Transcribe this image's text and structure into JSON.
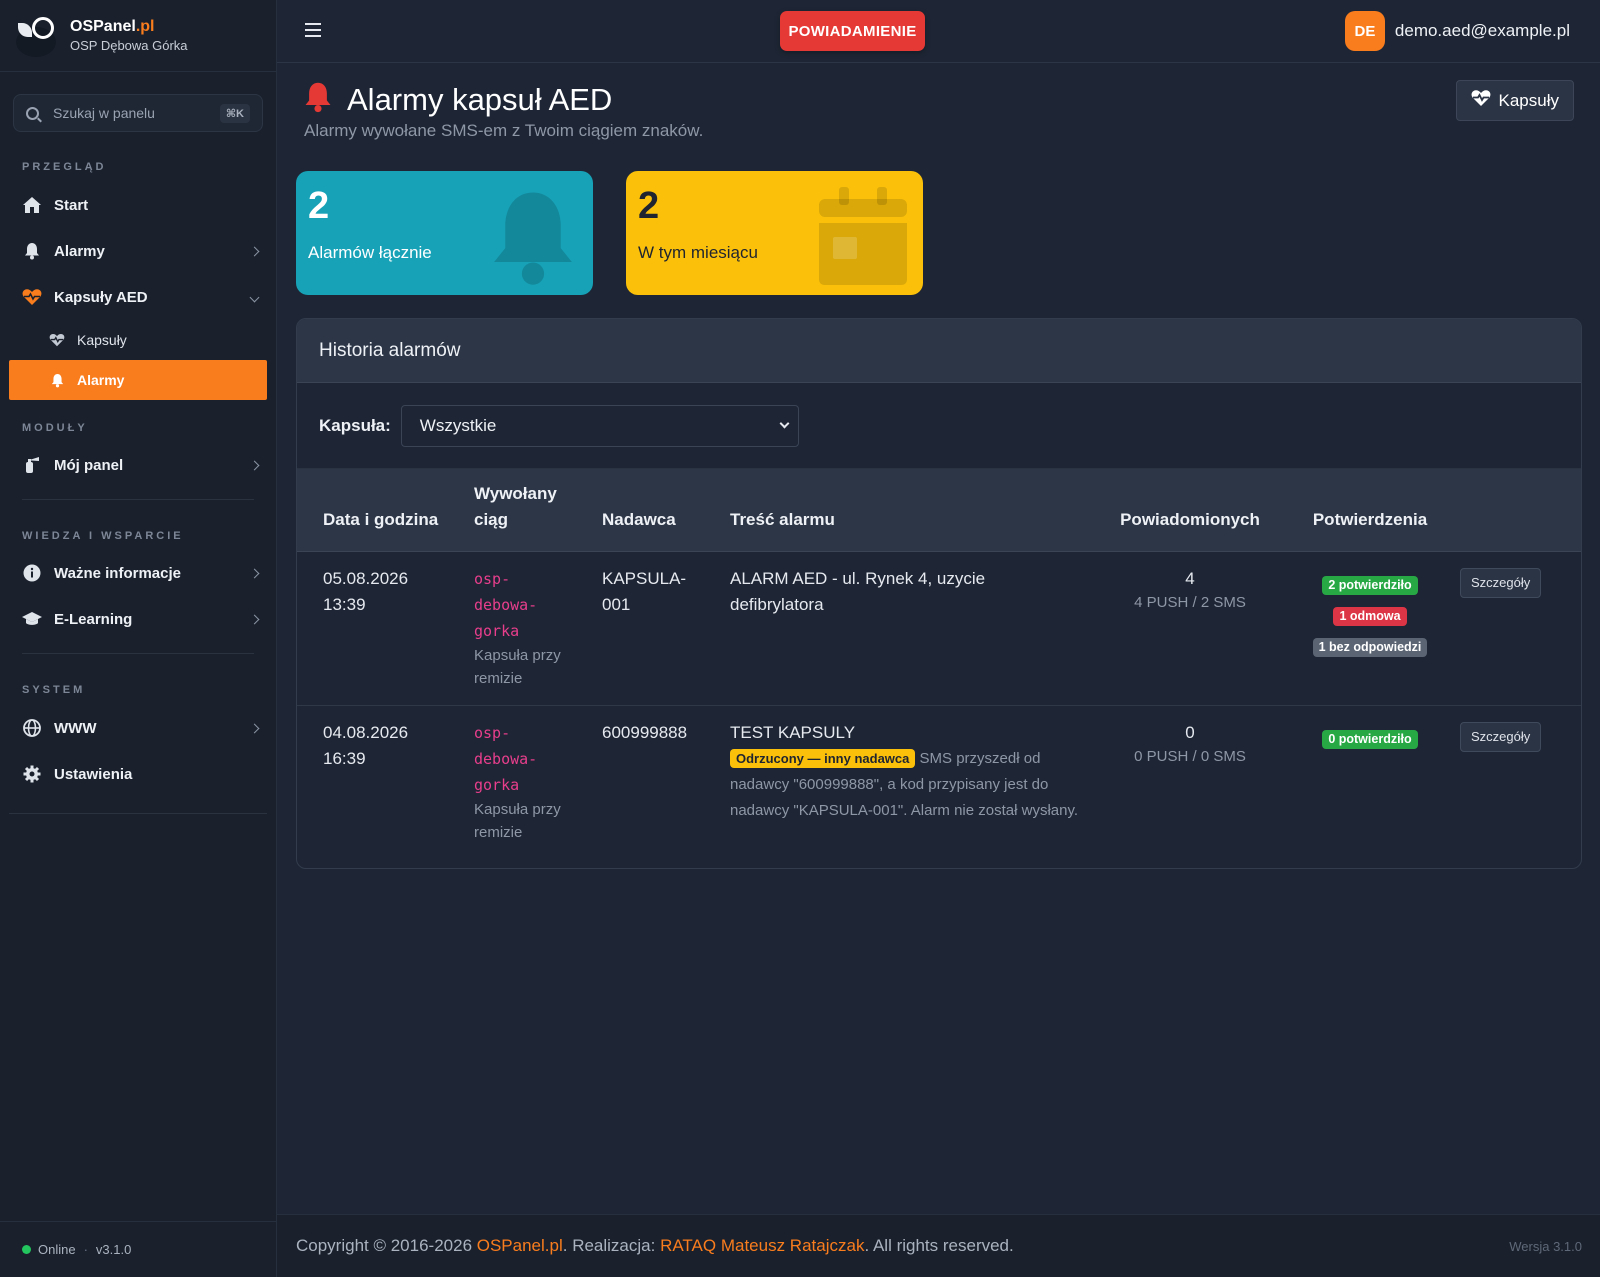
{
  "brand": {
    "name": "OSPanel",
    "tld": ".pl",
    "subtitle": "OSP Dębowa Górka"
  },
  "search": {
    "placeholder": "Szukaj w panelu",
    "shortcut": "⌘K"
  },
  "sidebar": {
    "sections": {
      "przeglad": "PRZEGLĄD",
      "moduly": "MODUŁY",
      "wiedza": "WIEDZA I WSPARCIE",
      "system": "SYSTEM"
    },
    "items": {
      "start": "Start",
      "alarmy": "Alarmy",
      "kapsuly_aed": "Kapsuły AED",
      "kapsuly_sub": "Kapsuły",
      "alarmy_sub": "Alarmy",
      "moj_panel": "Mój panel",
      "wazne": "Ważne informacje",
      "elearning": "E-Learning",
      "www": "WWW",
      "ustawienia": "Ustawienia"
    },
    "status": {
      "online": "Online",
      "version": "v3.1.0"
    }
  },
  "topbar": {
    "notify_label": "POWIADAMIENIE",
    "avatar_initials": "DE",
    "user_email": "demo.aed@example.pl"
  },
  "page": {
    "title": "Alarmy kapsuł AED",
    "subtitle": "Alarmy wywołane SMS-em z Twoim ciągiem znaków.",
    "kapsuly_button": "Kapsuły"
  },
  "stats": [
    {
      "value": "2",
      "label": "Alarmów łącznie",
      "icon": "bell-icon",
      "color": "#17a2b8"
    },
    {
      "value": "2",
      "label": "W tym miesiącu",
      "icon": "calendar-icon",
      "color": "#fbc10a"
    }
  ],
  "history": {
    "title": "Historia alarmów",
    "filter_label": "Kapsuła:",
    "filter_value": "Wszystkie",
    "columns": {
      "date": "Data i godzina",
      "ciag": "Wywołany ciąg",
      "nadawca": "Nadawca",
      "tresc": "Treść alarmu",
      "pow": "Powiadomionych",
      "pot": "Potwierdzenia"
    },
    "rows": [
      {
        "date": "05.08.2026",
        "time": "13:39",
        "ciag": "osp-debowa-gorka",
        "ciag_desc": "Kapsuła przy remizie",
        "nadawca": "KAPSULA-001",
        "tresc": "ALARM AED - ul. Rynek 4, uzycie defibrylatora",
        "pow_count": "4",
        "pow_detail": "4 PUSH / 2 SMS",
        "confirmed": "2 potwierdziło",
        "rejected": "1 odmowa",
        "no_answer": "1 bez odpowiedzi",
        "details": "Szczegóły"
      },
      {
        "date": "04.08.2026",
        "time": "16:39",
        "ciag": "osp-debowa-gorka",
        "ciag_desc": "Kapsuła przy remizie",
        "nadawca": "600999888",
        "tresc": "TEST KAPSULY",
        "reject_badge": "Odrzucony — inny nadawca",
        "reject_reason": "SMS przyszedł od nadawcy \"600999888\", a kod przypisany jest do nadawcy \"KAPSULA-001\". Alarm nie został wysłany.",
        "pow_count": "0",
        "pow_detail": "0 PUSH / 0 SMS",
        "confirmed": "0 potwierdziło",
        "details": "Szczegóły"
      }
    ]
  },
  "footer": {
    "copyright": "Copyright © 2016-2026 ",
    "link1": "OSPanel.pl",
    "middle": ". Realizacja: ",
    "link2": "RATAQ Mateusz Ratajczak",
    "end": ". All rights reserved.",
    "version": "Wersja 3.1.0"
  },
  "colors": {
    "accent": "#f97c1d",
    "danger": "#e53935",
    "teal": "#17a2b8",
    "yellow": "#fbc10a"
  }
}
